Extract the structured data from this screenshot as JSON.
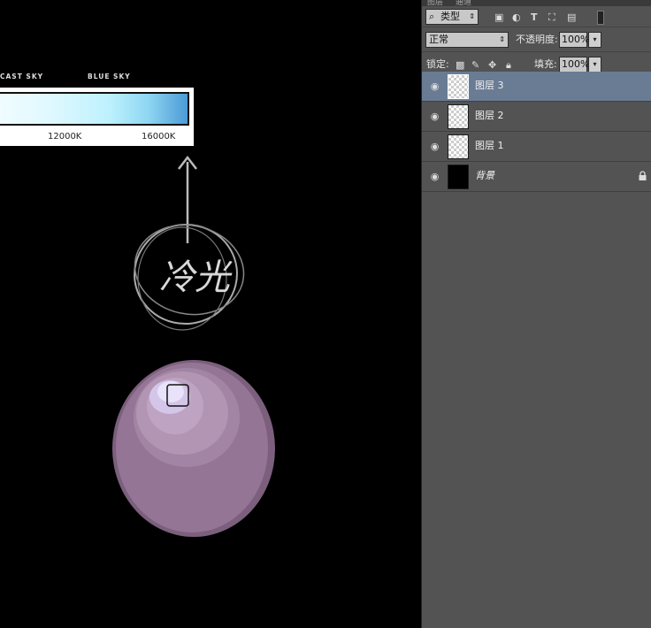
{
  "canvas": {
    "chart_labels": {
      "left": "CAST SKY",
      "right": "BLUE SKY"
    },
    "ticks": [
      "12000K",
      "16000K"
    ],
    "sketch_text": "冷光"
  },
  "panel": {
    "tabs": [
      "图层",
      "通道"
    ],
    "filter": {
      "label": "类型"
    },
    "blend_mode": "正常",
    "opacity": {
      "label": "不透明度:",
      "value": "100%"
    },
    "lock": {
      "label": "锁定:"
    },
    "fill": {
      "label": "填充:",
      "value": "100%"
    },
    "layers": [
      {
        "name": "图层 3",
        "selected": true
      },
      {
        "name": "图层 2",
        "selected": false
      },
      {
        "name": "图层 1",
        "selected": false
      },
      {
        "name": "背景",
        "selected": false,
        "locked": true
      }
    ]
  }
}
